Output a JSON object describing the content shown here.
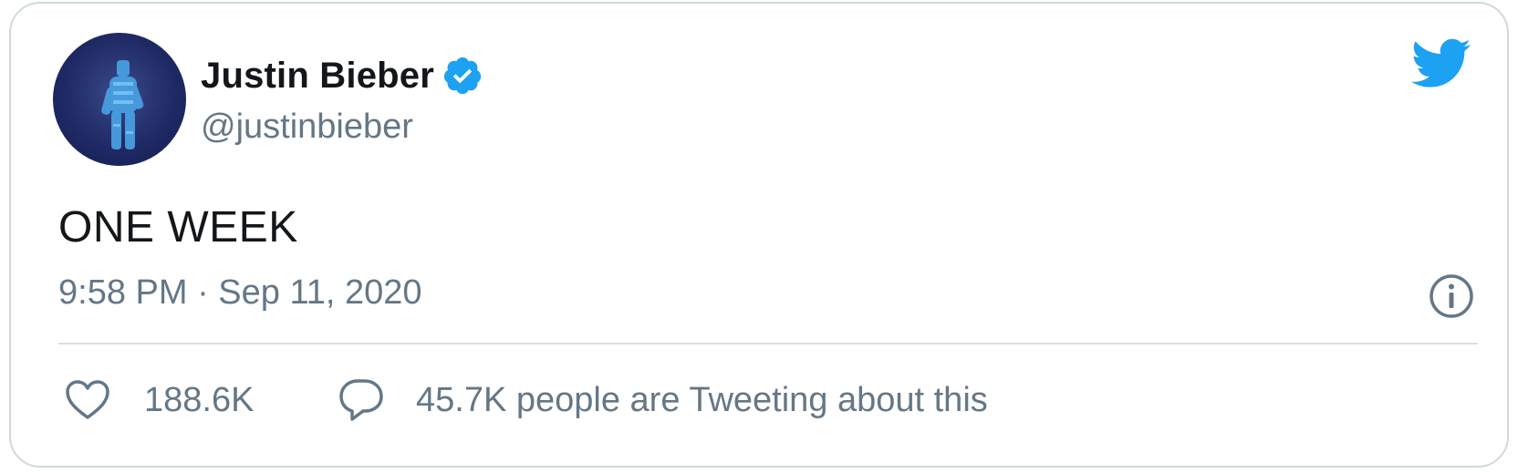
{
  "author": {
    "name": "Justin Bieber",
    "handle": "@justinbieber",
    "verified": true
  },
  "tweet": {
    "text": "ONE WEEK",
    "timestamp": "9:58 PM · Sep 11, 2020"
  },
  "stats": {
    "likes": "188.6K",
    "tweeting_about": "45.7K people are Tweeting about this"
  },
  "icons": {
    "brand": "twitter-bird-icon",
    "verified": "verified-badge-icon",
    "info": "info-icon",
    "like": "heart-icon",
    "reply": "speech-bubble-icon"
  },
  "colors": {
    "twitter_blue": "#1da1f2",
    "text_primary": "#14171a",
    "text_secondary": "#657786",
    "divider": "#d9dee2"
  }
}
